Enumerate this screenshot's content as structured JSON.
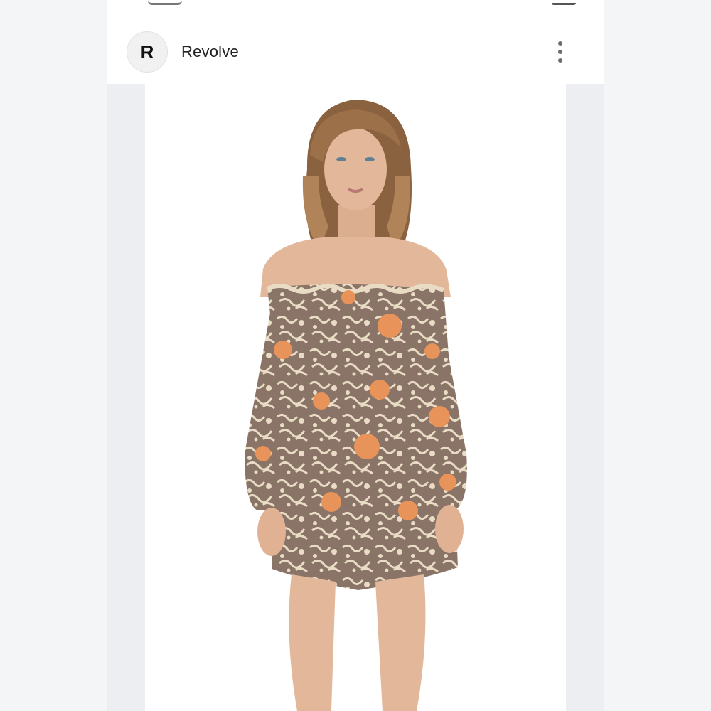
{
  "header": {
    "avatar_letter": "R",
    "store_name": "Revolve",
    "menu_icon": "more-vertical-icon"
  },
  "product_image": {
    "description_icon": "product-photo",
    "colors": {
      "dress": "#8a7468",
      "pattern": "#e9dcc4",
      "flower": "#e8935a",
      "skin": "#e3b79a",
      "hair": "#8a6240"
    }
  }
}
